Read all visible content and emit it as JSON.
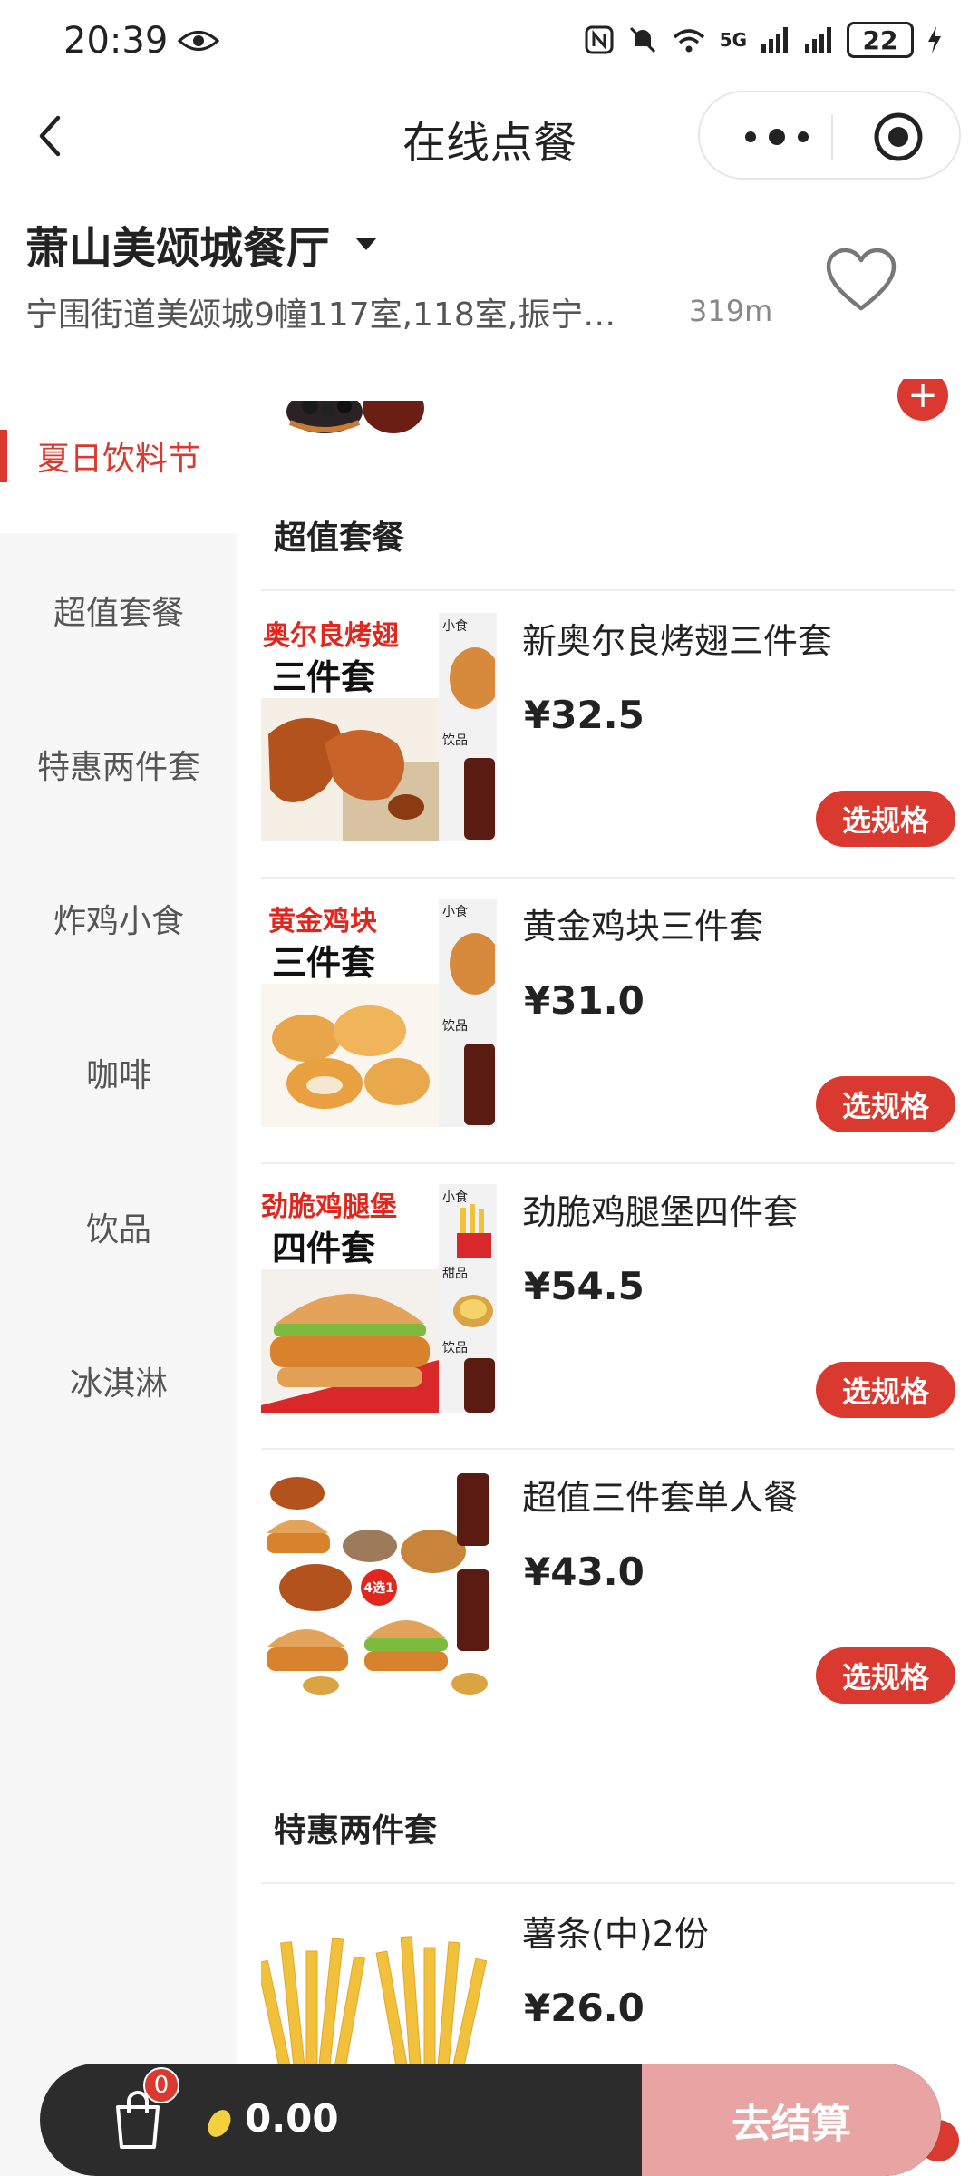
{
  "status_bar": {
    "time": "20:39",
    "battery": "22",
    "network": "5G"
  },
  "header": {
    "title": "在线点餐"
  },
  "store": {
    "name": "萧山美颂城餐厅",
    "address": "宁围街道美颂城9幢117室,118室,振宁…",
    "distance": "319m"
  },
  "sidebar": {
    "items": [
      {
        "label": "夏日饮料节",
        "active": true
      },
      {
        "label": "超值套餐"
      },
      {
        "label": "特惠两件套"
      },
      {
        "label": "炸鸡小食"
      },
      {
        "label": "咖啡"
      },
      {
        "label": "饮品"
      },
      {
        "label": "冰淇淋"
      }
    ]
  },
  "sections": [
    {
      "title": "超值套餐",
      "items": [
        {
          "name": "新奥尔良烤翅三件套",
          "price": "¥32.5",
          "button": "选规格",
          "img_title_red": "奥尔良烤翅",
          "img_title_black": "三件套",
          "img_tags": [
            "小食",
            "饮品"
          ]
        },
        {
          "name": "黄金鸡块三件套",
          "price": "¥31.0",
          "button": "选规格",
          "img_title_red": "黄金鸡块",
          "img_title_black": "三件套",
          "img_tags": [
            "小食",
            "饮品"
          ]
        },
        {
          "name": "劲脆鸡腿堡四件套",
          "price": "¥54.5",
          "button": "选规格",
          "img_title_red": "劲脆鸡腿堡",
          "img_title_black": "四件套",
          "img_tags": [
            "小食",
            "甜品",
            "饮品"
          ]
        },
        {
          "name": "超值三件套单人餐",
          "price": "¥43.0",
          "button": "选规格",
          "img_badge": "4选1"
        }
      ]
    },
    {
      "title": "特惠两件套",
      "items": [
        {
          "name": "薯条(中)2份",
          "price": "¥26.0"
        }
      ]
    }
  ],
  "cart": {
    "count": "0",
    "total": "0.00",
    "checkout_label": "去结算"
  },
  "colors": {
    "accent": "#d9392e",
    "checkout_disabled": "#e8a3a3",
    "cart_bar": "#2c2c2c"
  }
}
